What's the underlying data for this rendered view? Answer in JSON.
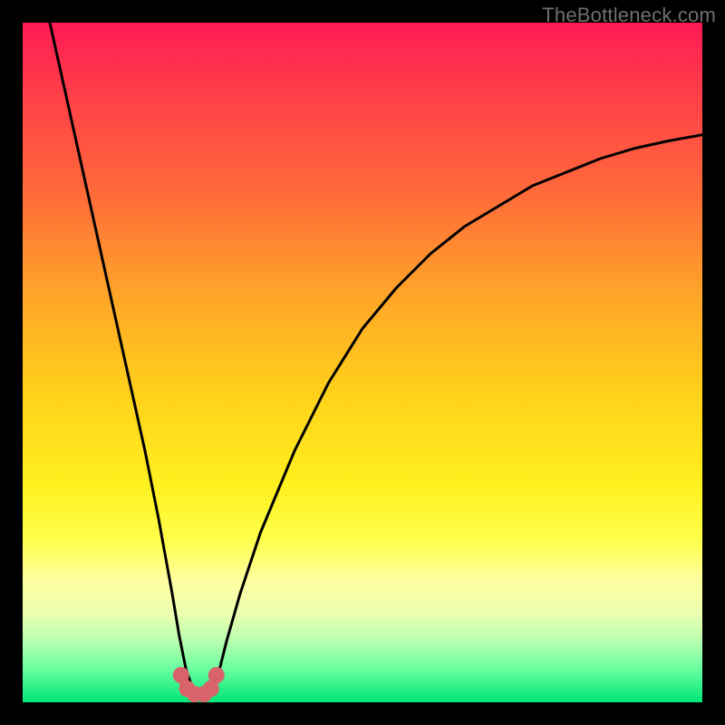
{
  "watermark": "TheBottleneck.com",
  "colors": {
    "background": "#000000",
    "curve_stroke": "#000000",
    "marker_fill": "#d9636b",
    "gradient_stops": [
      {
        "pct": 0,
        "hex": "#ff1a55"
      },
      {
        "pct": 10,
        "hex": "#ff3d49"
      },
      {
        "pct": 25,
        "hex": "#ff6a3a"
      },
      {
        "pct": 40,
        "hex": "#ffa528"
      },
      {
        "pct": 55,
        "hex": "#ffd21a"
      },
      {
        "pct": 68,
        "hex": "#fff01f"
      },
      {
        "pct": 76,
        "hex": "#ffff4a"
      },
      {
        "pct": 82,
        "hex": "#ffffa0"
      },
      {
        "pct": 87,
        "hex": "#eaffb0"
      },
      {
        "pct": 91,
        "hex": "#b8ffb0"
      },
      {
        "pct": 95,
        "hex": "#6affa0"
      },
      {
        "pct": 100,
        "hex": "#00e676"
      }
    ]
  },
  "chart_data": {
    "type": "line",
    "title": "",
    "xlabel": "",
    "ylabel": "",
    "xlim": [
      0,
      100
    ],
    "ylim": [
      0,
      100
    ],
    "grid": false,
    "series": [
      {
        "name": "left_branch",
        "x": [
          4,
          6,
          8,
          10,
          12,
          14,
          16,
          18,
          20,
          22,
          23,
          24,
          25
        ],
        "values": [
          100,
          91,
          82,
          73,
          64,
          55,
          46,
          37,
          27,
          16,
          10,
          5,
          2
        ]
      },
      {
        "name": "right_branch",
        "x": [
          28,
          29,
          30,
          32,
          35,
          40,
          45,
          50,
          55,
          60,
          65,
          70,
          75,
          80,
          85,
          90,
          95,
          100
        ],
        "values": [
          2,
          5,
          9,
          16,
          25,
          37,
          47,
          55,
          61,
          66,
          70,
          73,
          76,
          78,
          80,
          81.5,
          82.6,
          83.5
        ]
      }
    ],
    "markers": [
      {
        "x": 23.3,
        "y": 4.0
      },
      {
        "x": 24.2,
        "y": 2.0
      },
      {
        "x": 25.3,
        "y": 1.2
      },
      {
        "x": 26.7,
        "y": 1.2
      },
      {
        "x": 27.7,
        "y": 2.0
      },
      {
        "x": 28.5,
        "y": 4.0
      }
    ],
    "valley_path": {
      "x": [
        23.3,
        24.2,
        25.3,
        26.7,
        27.7,
        28.5
      ],
      "values": [
        4.0,
        2.0,
        1.2,
        1.2,
        2.0,
        4.0
      ]
    }
  }
}
